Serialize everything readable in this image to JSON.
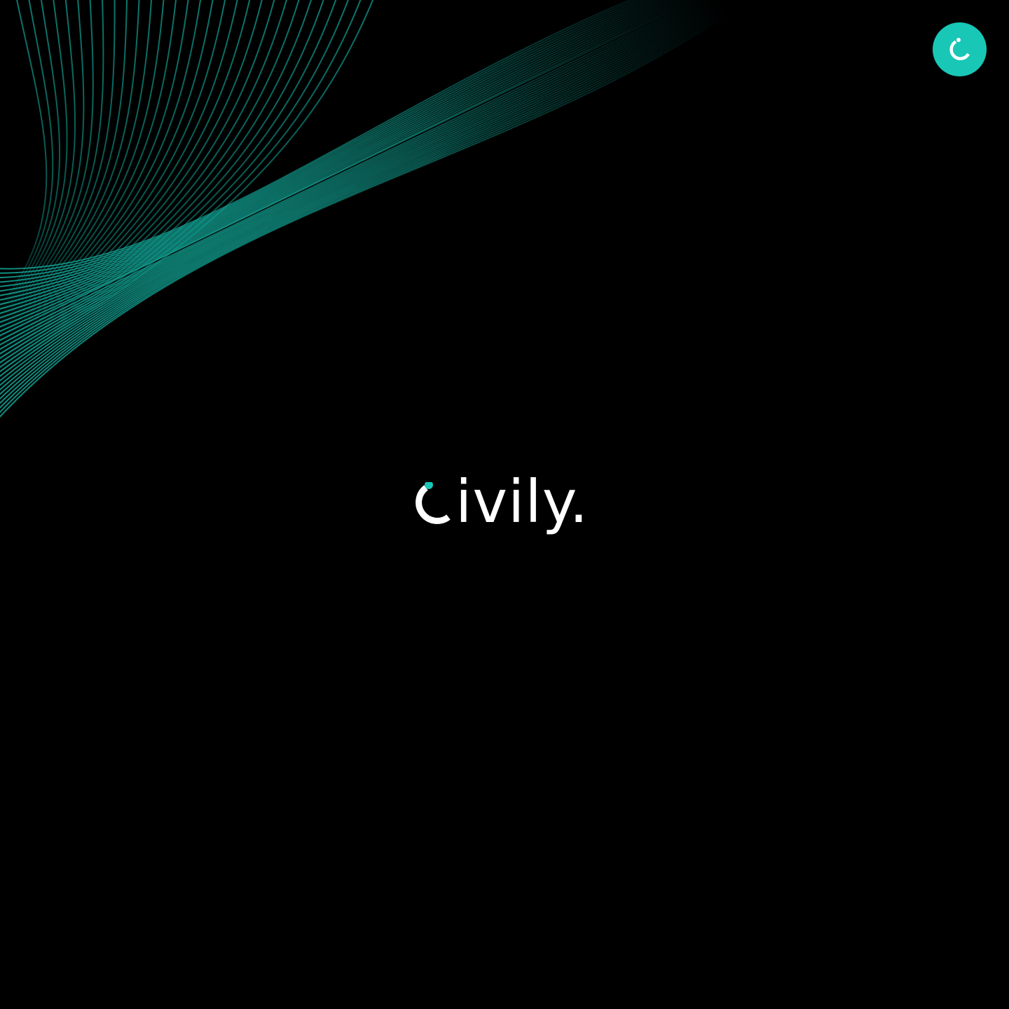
{
  "brand": {
    "wordmark_rest": "ivily.",
    "wordmark_full": "Civily.",
    "logo_icon": "civily-c-logo-icon",
    "text_color": "#ffffff",
    "accent_color": "#19c7b6"
  },
  "header": {
    "badge_icon": "civily-c-mark-icon"
  },
  "background": {
    "color": "#000000",
    "decoration": "teal-line-wave-icon",
    "line_color": "#16a89b"
  }
}
